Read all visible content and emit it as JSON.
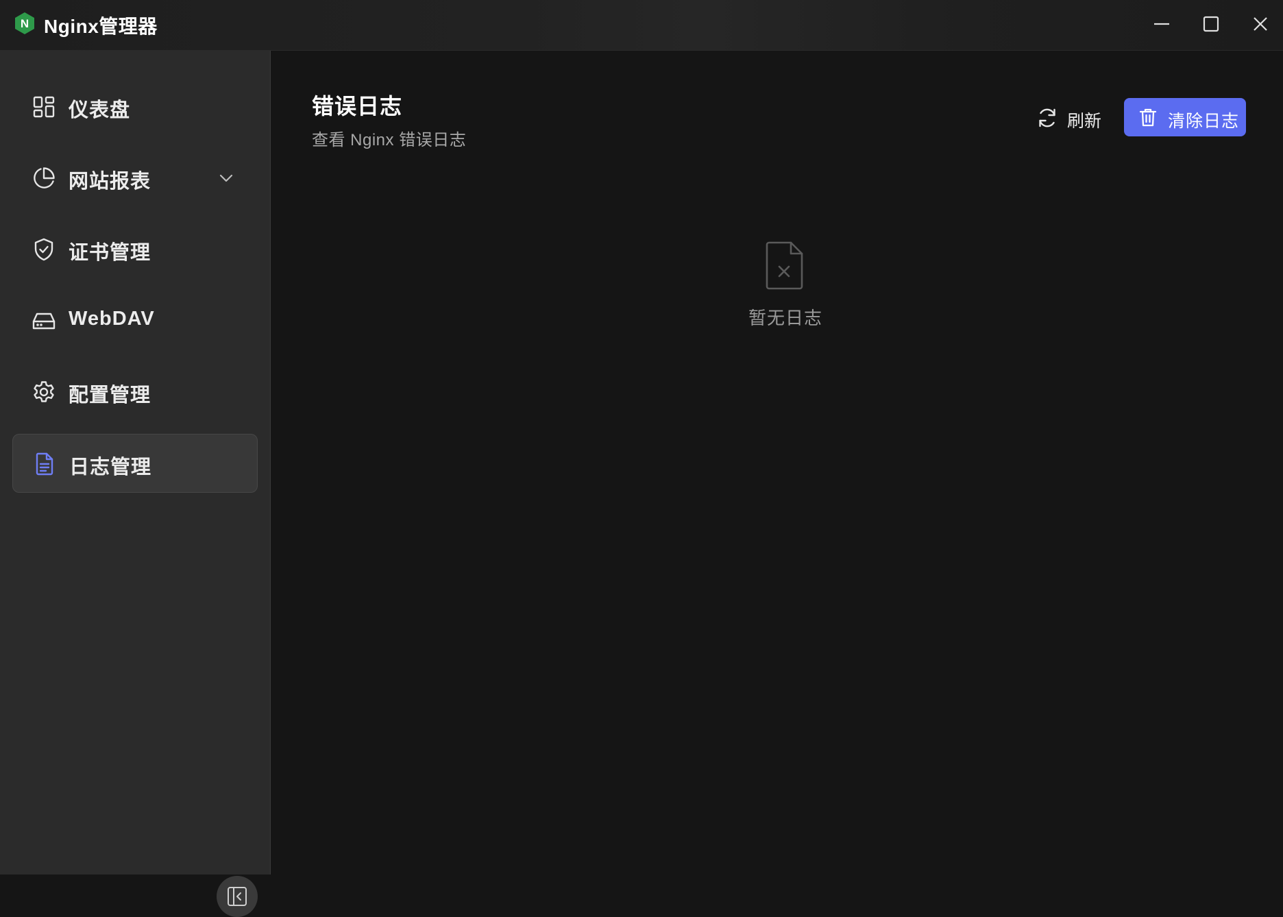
{
  "window": {
    "title": "Nginx管理器",
    "logo_letter": "N",
    "accent": "#5b6cf0",
    "logo_color": "#2e9a4a"
  },
  "sidebar": {
    "items": [
      {
        "label": "仪表盘",
        "icon": "dashboard-grid-icon",
        "active": false
      },
      {
        "label": "网站报表",
        "icon": "pie-chart-icon",
        "active": false,
        "expandable": true
      },
      {
        "label": "证书管理",
        "icon": "shield-check-icon",
        "active": false
      },
      {
        "label": "WebDAV",
        "icon": "hard-drive-icon",
        "active": false
      },
      {
        "label": "配置管理",
        "icon": "gear-icon",
        "active": false
      },
      {
        "label": "日志管理",
        "icon": "document-icon",
        "active": true
      }
    ]
  },
  "main": {
    "title": "错误日志",
    "subtitle": "查看 Nginx 错误日志",
    "refresh_label": "刷新",
    "clear_label": "清除日志",
    "empty_text": "暂无日志"
  }
}
